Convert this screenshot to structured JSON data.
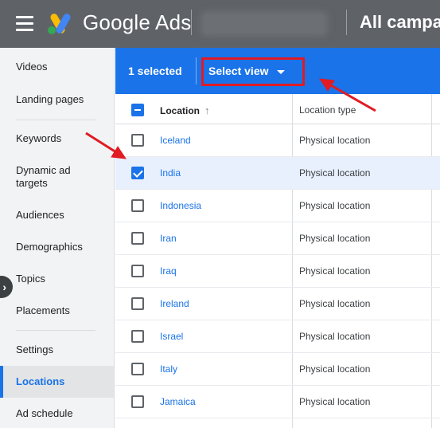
{
  "header": {
    "product_name": "Google Ads",
    "page_heading": "All campai"
  },
  "sidebar": {
    "items": [
      {
        "label": "Videos",
        "active": false
      },
      {
        "label": "Landing pages",
        "active": false
      },
      {
        "label": "Keywords",
        "active": false
      },
      {
        "label": "Dynamic ad targets",
        "active": false
      },
      {
        "label": "Audiences",
        "active": false
      },
      {
        "label": "Demographics",
        "active": false
      },
      {
        "label": "Topics",
        "active": false
      },
      {
        "label": "Placements",
        "active": false
      },
      {
        "label": "Settings",
        "active": false
      },
      {
        "label": "Locations",
        "active": true
      },
      {
        "label": "Ad schedule",
        "active": false
      }
    ],
    "collapse_icon": "chevron-right-icon"
  },
  "selection_bar": {
    "count_label": "1 selected",
    "select_view_label": "Select view"
  },
  "table": {
    "columns": [
      "Location",
      "Location type"
    ],
    "sorted_column": "Location",
    "rows": [
      {
        "location": "Iceland",
        "type": "Physical location",
        "checked": false
      },
      {
        "location": "India",
        "type": "Physical location",
        "checked": true
      },
      {
        "location": "Indonesia",
        "type": "Physical location",
        "checked": false
      },
      {
        "location": "Iran",
        "type": "Physical location",
        "checked": false
      },
      {
        "location": "Iraq",
        "type": "Physical location",
        "checked": false
      },
      {
        "location": "Ireland",
        "type": "Physical location",
        "checked": false
      },
      {
        "location": "Israel",
        "type": "Physical location",
        "checked": false
      },
      {
        "location": "Italy",
        "type": "Physical location",
        "checked": false
      },
      {
        "location": "Jamaica",
        "type": "Physical location",
        "checked": false
      }
    ]
  },
  "colors": {
    "topbar": "#5f6368",
    "accent": "#1a73e8",
    "annotation": "#e01b24"
  }
}
